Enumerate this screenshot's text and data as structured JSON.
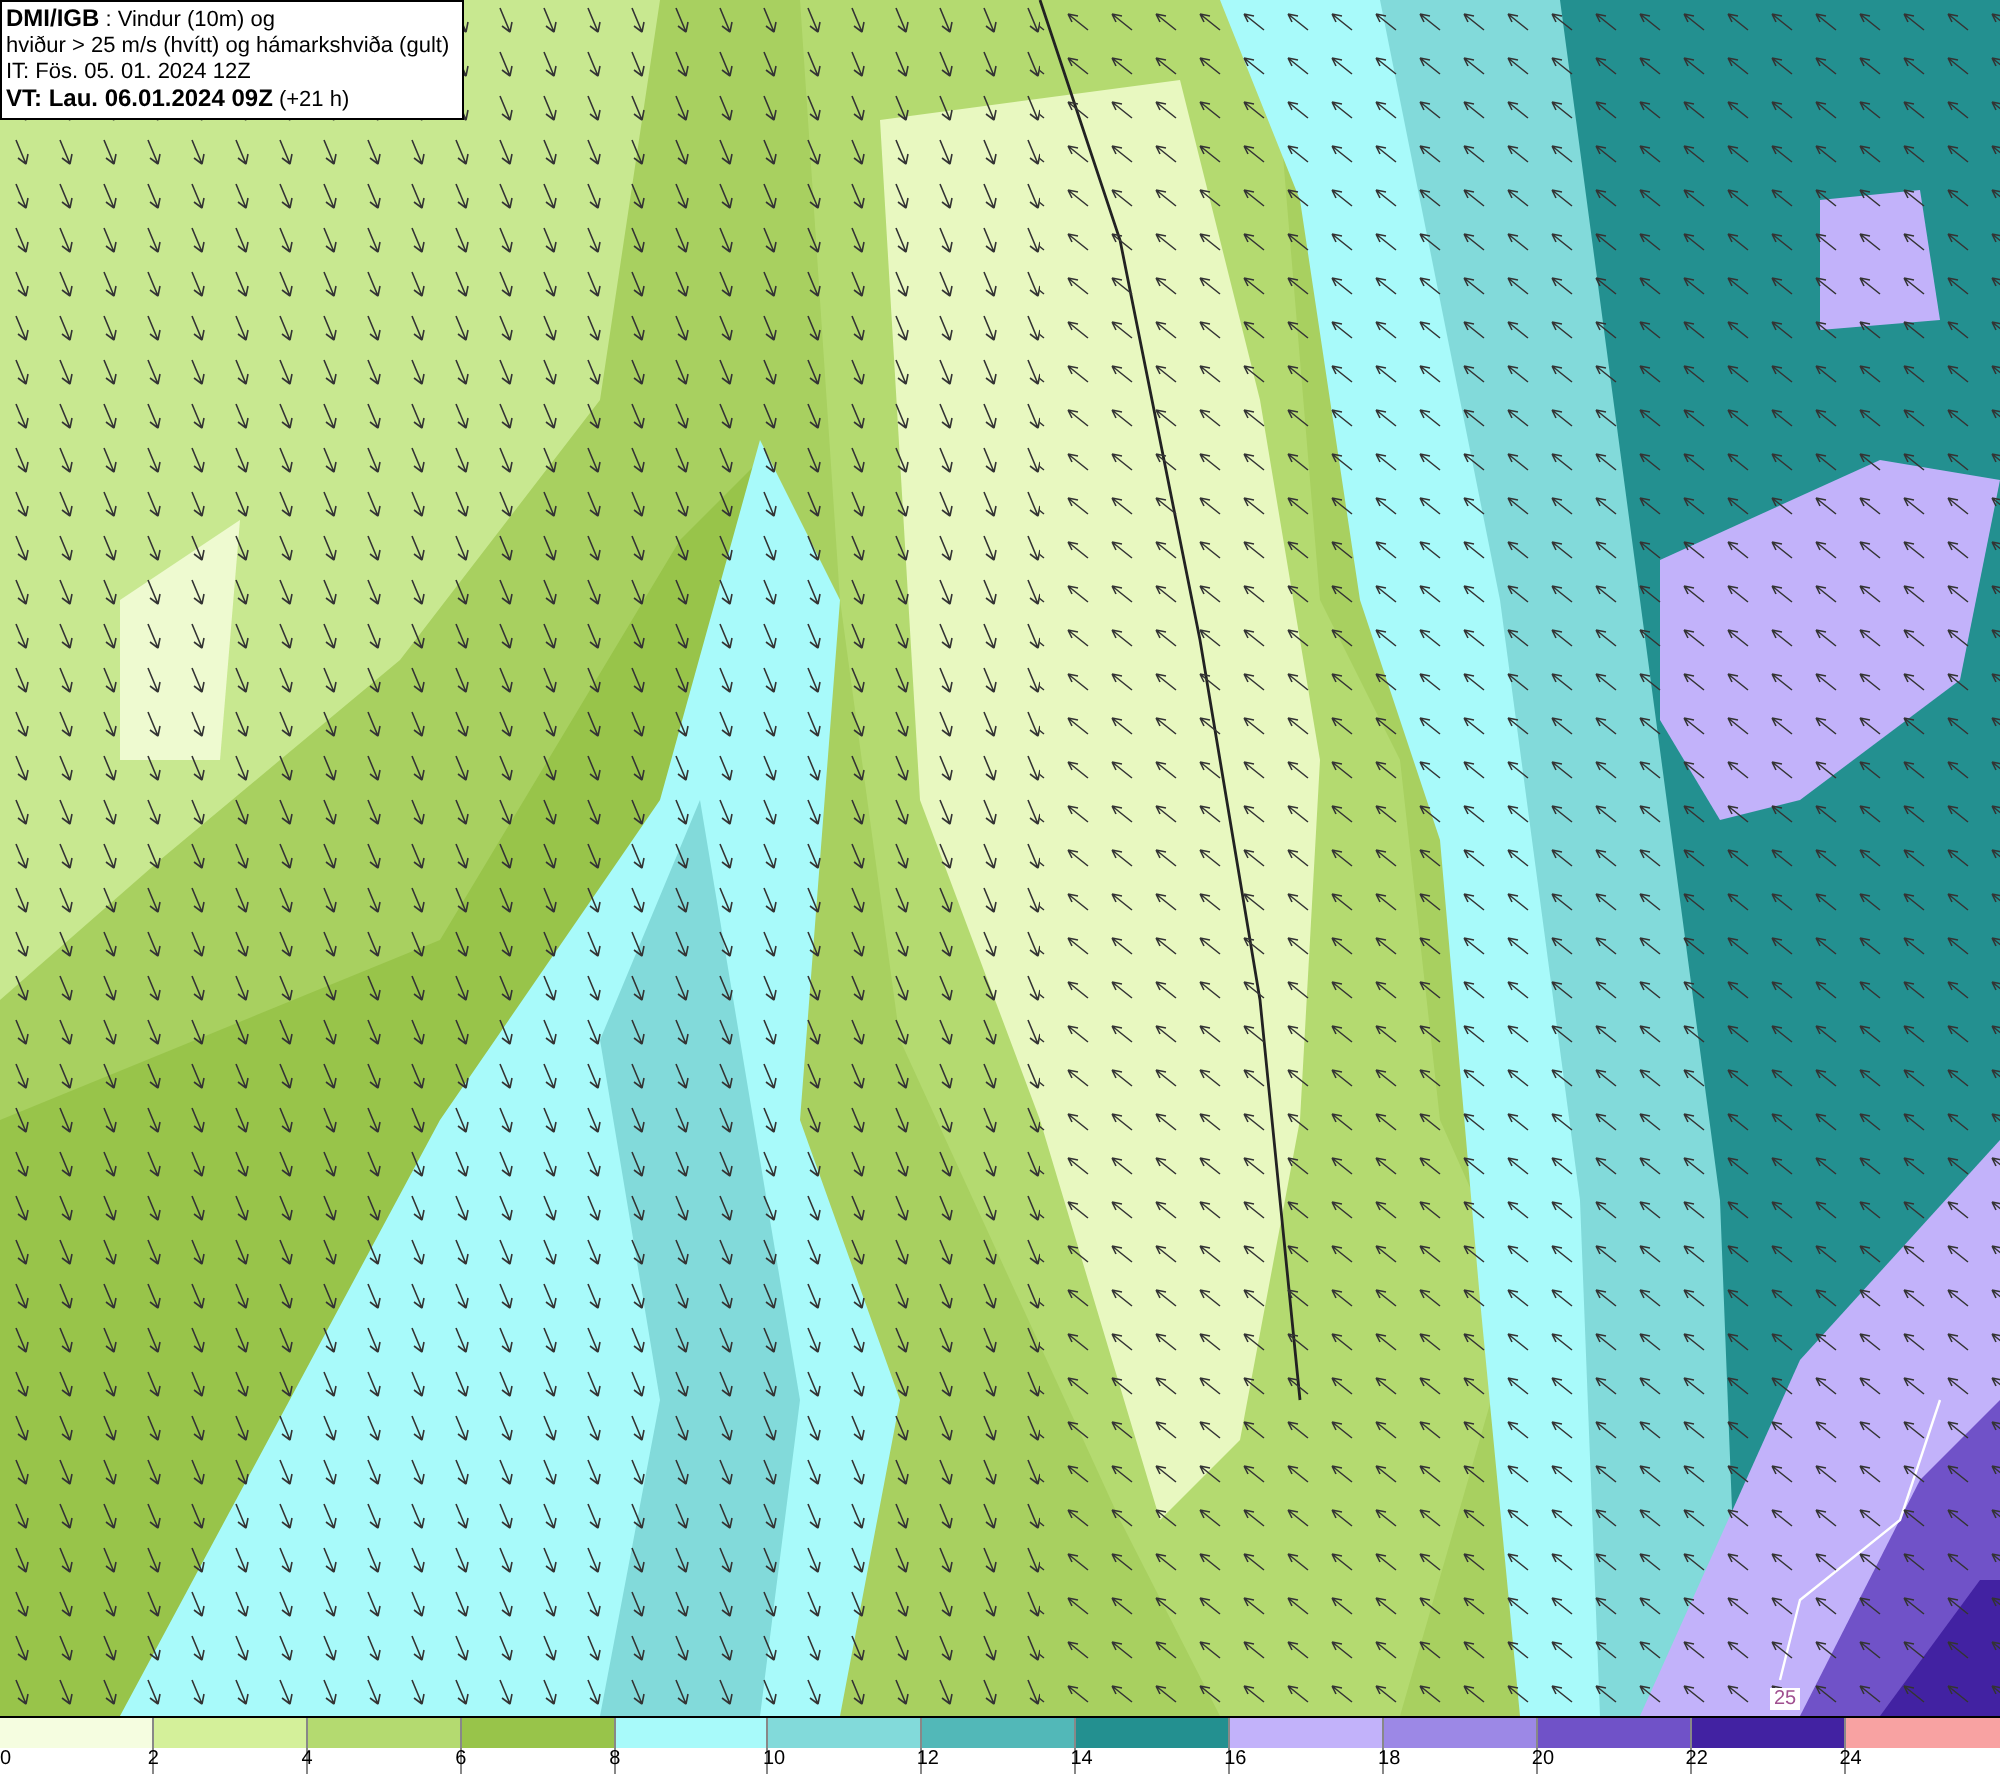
{
  "header": {
    "lines": [
      "**DMI/IGB** : Vindur (10m) og",
      "hviður > 25 m/s (hvítt) og hámarkshviða (gult)",
      "IT: Fös. 05. 01. 2024 12Z",
      "**VT: Lau. 06.01.2024 09Z** (+21 h)"
    ]
  },
  "map": {
    "contour_label": "25"
  },
  "legend": [
    {
      "label": "0",
      "color": "#f5fde0"
    },
    {
      "label": "2",
      "color": "#d4f09a"
    },
    {
      "label": "4",
      "color": "#b4da70"
    },
    {
      "label": "6",
      "color": "#98c44a"
    },
    {
      "label": "8",
      "color": "#a8fafa"
    },
    {
      "label": "10",
      "color": "#82dada"
    },
    {
      "label": "12",
      "color": "#52b8b8"
    },
    {
      "label": "14",
      "color": "#239090"
    },
    {
      "label": "16",
      "color": "#c2b2fa"
    },
    {
      "label": "18",
      "color": "#9c88e6"
    },
    {
      "label": "20",
      "color": "#7052c8"
    },
    {
      "label": "22",
      "color": "#4222a2"
    },
    {
      "label": "24",
      "color": "#f8a2a2"
    }
  ]
}
